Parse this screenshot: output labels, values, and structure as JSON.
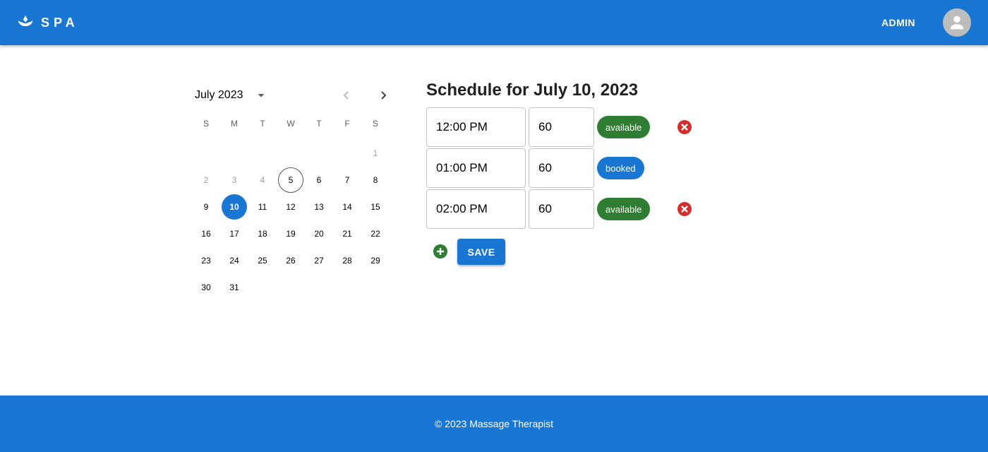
{
  "header": {
    "brand": "SPA",
    "admin_label": "ADMIN"
  },
  "calendar": {
    "month_label": "July 2023",
    "day_headers": [
      "S",
      "M",
      "T",
      "W",
      "T",
      "F",
      "S"
    ],
    "weeks": [
      [
        "",
        "",
        "",
        "",
        "",
        "",
        "1"
      ],
      [
        "2",
        "3",
        "4",
        "5",
        "6",
        "7",
        "8"
      ],
      [
        "9",
        "10",
        "11",
        "12",
        "13",
        "14",
        "15"
      ],
      [
        "16",
        "17",
        "18",
        "19",
        "20",
        "21",
        "22"
      ],
      [
        "23",
        "24",
        "25",
        "26",
        "27",
        "28",
        "29"
      ],
      [
        "30",
        "31",
        "",
        "",
        "",
        "",
        ""
      ]
    ],
    "disabled_days": [
      "1",
      "2",
      "3",
      "4"
    ],
    "today": "5",
    "selected": "10"
  },
  "schedule": {
    "title": "Schedule for July 10, 2023",
    "slots": [
      {
        "time": "12:00 PM",
        "duration": "60",
        "status": "available",
        "status_color": "#2e7d32",
        "removable": true
      },
      {
        "time": "01:00 PM",
        "duration": "60",
        "status": "booked",
        "status_color": "#1976d2",
        "removable": false
      },
      {
        "time": "02:00 PM",
        "duration": "60",
        "status": "available",
        "status_color": "#2e7d32",
        "removable": true
      }
    ],
    "save_label": "SAVE"
  },
  "footer": {
    "text": "© 2023 Massage Therapist"
  },
  "colors": {
    "primary": "#1976d2",
    "success": "#2e7d32",
    "danger": "#d32f2f"
  }
}
